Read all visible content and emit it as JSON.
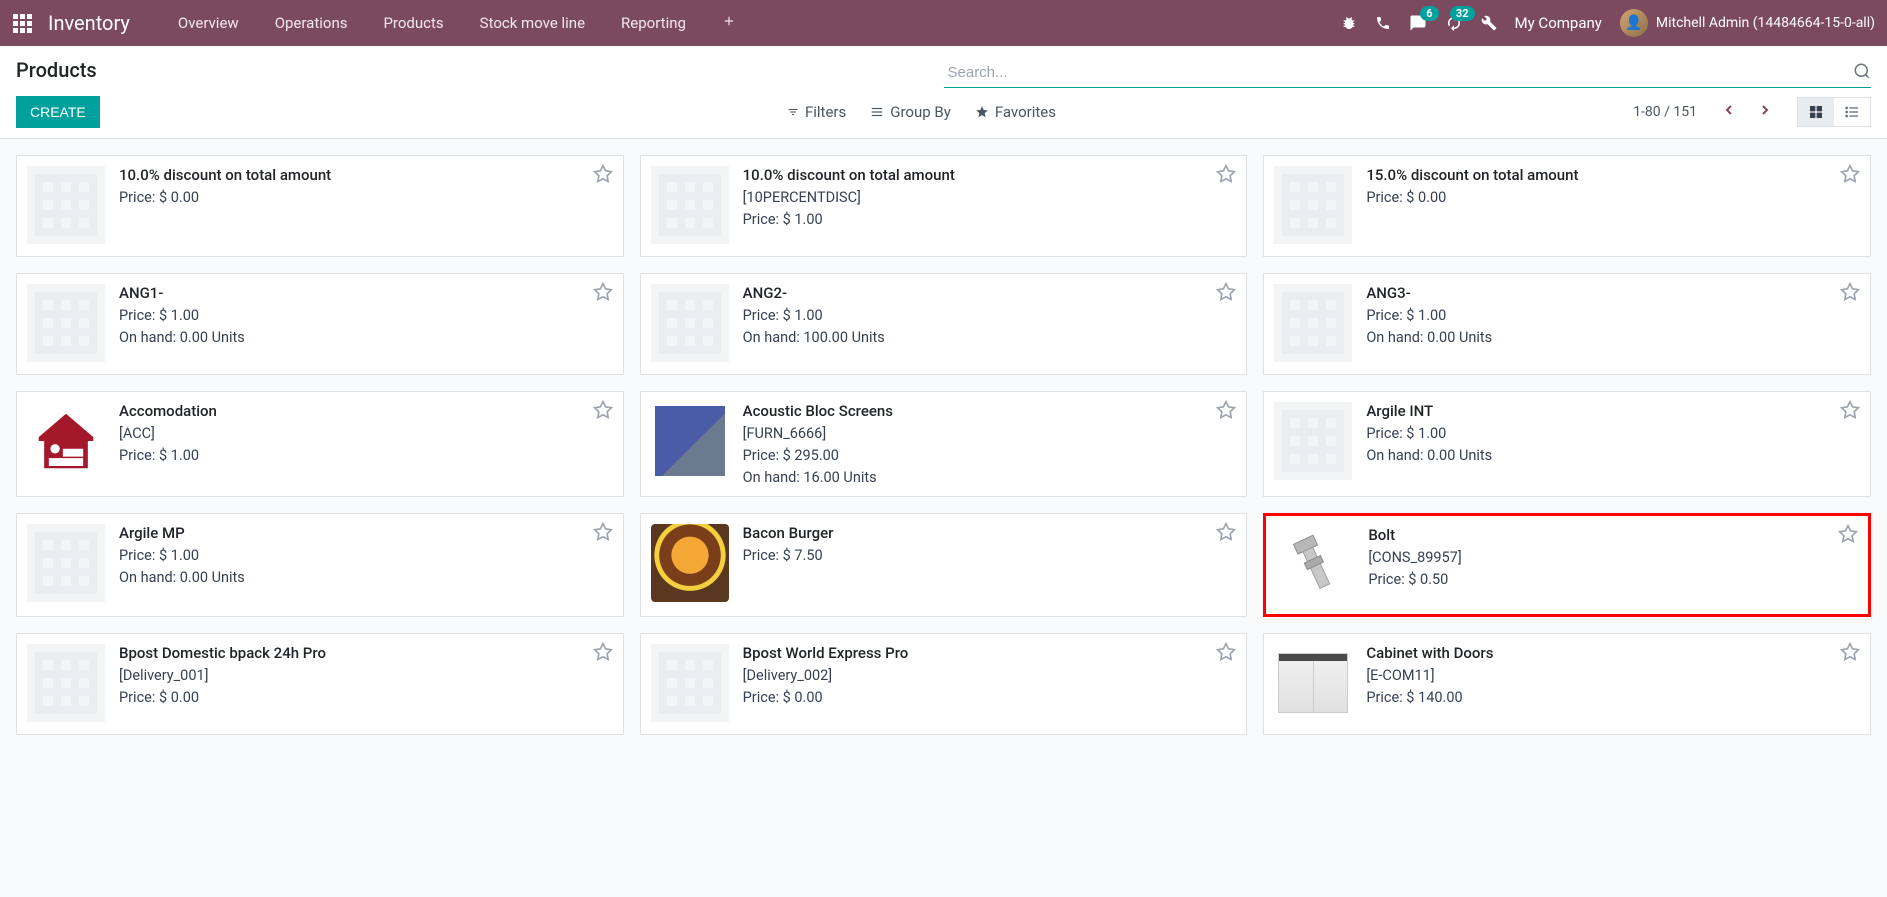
{
  "navbar": {
    "brand": "Inventory",
    "menu": [
      "Overview",
      "Operations",
      "Products",
      "Stock move line",
      "Reporting"
    ],
    "messaging_badge": "6",
    "activities_badge": "32",
    "company": "My Company",
    "user": "Mitchell Admin (14484664-15-0-all)"
  },
  "control": {
    "title": "Products",
    "create": "CREATE",
    "search_placeholder": "Search...",
    "filters": "Filters",
    "groupby": "Group By",
    "favorites": "Favorites",
    "pager": "1-80 / 151"
  },
  "products": [
    {
      "name": "10.0% discount on total amount",
      "ref": "",
      "price": "Price: $ 0.00",
      "onhand": "",
      "img": "placeholder"
    },
    {
      "name": "10.0% discount on total amount",
      "ref": "[10PERCENTDISC]",
      "price": "Price: $ 1.00",
      "onhand": "",
      "img": "placeholder"
    },
    {
      "name": "15.0% discount on total amount",
      "ref": "",
      "price": "Price: $ 0.00",
      "onhand": "",
      "img": "placeholder"
    },
    {
      "name": "ANG1-",
      "ref": "",
      "price": "Price: $ 1.00",
      "onhand": "On hand: 0.00 Units",
      "img": "placeholder"
    },
    {
      "name": "ANG2-",
      "ref": "",
      "price": "Price: $ 1.00",
      "onhand": "On hand: 100.00 Units",
      "img": "placeholder"
    },
    {
      "name": "ANG3-",
      "ref": "",
      "price": "Price: $ 1.00",
      "onhand": "On hand: 0.00 Units",
      "img": "placeholder"
    },
    {
      "name": "Accomodation",
      "ref": "[ACC]",
      "price": "Price: $ 1.00",
      "onhand": "",
      "img": "accom"
    },
    {
      "name": "Acoustic Bloc Screens",
      "ref": "[FURN_6666]",
      "price": "Price: $ 295.00",
      "onhand": "On hand: 16.00 Units",
      "img": "screen"
    },
    {
      "name": "Argile INT",
      "ref": "",
      "price": "Price: $ 1.00",
      "onhand": "On hand: 0.00 Units",
      "img": "placeholder"
    },
    {
      "name": "Argile MP",
      "ref": "",
      "price": "Price: $ 1.00",
      "onhand": "On hand: 0.00 Units",
      "img": "placeholder"
    },
    {
      "name": "Bacon Burger",
      "ref": "",
      "price": "Price: $ 7.50",
      "onhand": "",
      "img": "burger"
    },
    {
      "name": "Bolt",
      "ref": "[CONS_89957]",
      "price": "Price: $ 0.50",
      "onhand": "",
      "img": "bolt",
      "highlighted": true
    },
    {
      "name": "Bpost Domestic bpack 24h Pro",
      "ref": "[Delivery_001]",
      "price": "Price: $ 0.00",
      "onhand": "",
      "img": "placeholder"
    },
    {
      "name": "Bpost World Express Pro",
      "ref": "[Delivery_002]",
      "price": "Price: $ 0.00",
      "onhand": "",
      "img": "placeholder"
    },
    {
      "name": "Cabinet with Doors",
      "ref": "[E-COM11]",
      "price": "Price: $ 140.00",
      "onhand": "",
      "img": "cabinet"
    }
  ]
}
